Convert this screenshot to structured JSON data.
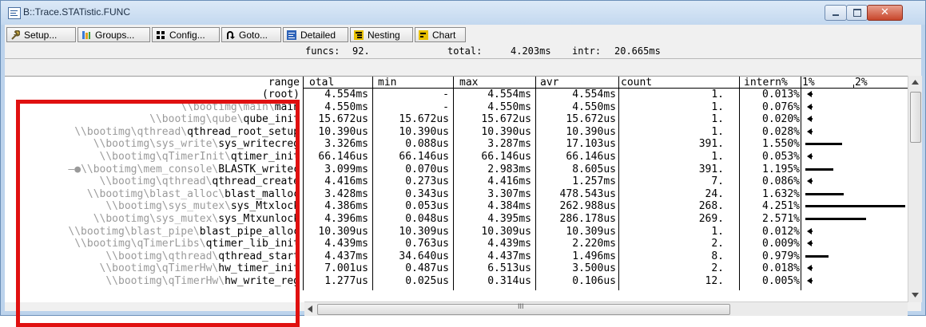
{
  "window": {
    "title": "B::Trace.STATistic.FUNC",
    "close_glyph": "✕"
  },
  "toolbar": {
    "setup": "Setup...",
    "groups": "Groups...",
    "config": "Config...",
    "goto": "Goto...",
    "detailed": "Detailed",
    "nesting": "Nesting",
    "chart": "Chart"
  },
  "info": {
    "funcs_label": "funcs:",
    "funcs_value": "92.",
    "total_label": "total:",
    "total_value": "4.203ms",
    "intr_label": "intr:",
    "intr_value": "20.665ms"
  },
  "columns": {
    "range": "range",
    "total": "otal",
    "min": "min",
    "max": "max",
    "avr": "avr",
    "count": "count",
    "intern": "intern%",
    "pct1": "1%",
    "pct2": "2%"
  },
  "scroll": {
    "hscroll_grip": "III"
  },
  "rows": [
    {
      "prefix": "",
      "name": "(root)",
      "total": "4.554ms",
      "min": "-",
      "max": "4.554ms",
      "avr": "4.554ms",
      "count": "1.",
      "intern": "0.013%",
      "intern_value": 0.013
    },
    {
      "prefix": "\\\\bootimg\\main\\",
      "name": "main",
      "total": "4.550ms",
      "min": "-",
      "max": "4.550ms",
      "avr": "4.550ms",
      "count": "1.",
      "intern": "0.076%",
      "intern_value": 0.076
    },
    {
      "prefix": "\\\\bootimg\\qube\\",
      "name": "qube_init",
      "total": "15.672us",
      "min": "15.672us",
      "max": "15.672us",
      "avr": "15.672us",
      "count": "1.",
      "intern": "0.020%",
      "intern_value": 0.02
    },
    {
      "prefix": "\\\\bootimg\\qthread\\",
      "name": "qthread_root_setup",
      "total": "10.390us",
      "min": "10.390us",
      "max": "10.390us",
      "avr": "10.390us",
      "count": "1.",
      "intern": "0.028%",
      "intern_value": 0.028
    },
    {
      "prefix": "\\\\bootimg\\sys_write\\",
      "name": "sys_writecreg",
      "total": "3.326ms",
      "min": "0.088us",
      "max": "3.287ms",
      "avr": "17.103us",
      "count": "391.",
      "intern": "1.550%",
      "intern_value": 1.55
    },
    {
      "prefix": "\\\\bootimg\\qTimerInit\\",
      "name": "qtimer_init",
      "total": "66.146us",
      "min": "66.146us",
      "max": "66.146us",
      "avr": "66.146us",
      "count": "1.",
      "intern": "0.053%",
      "intern_value": 0.053
    },
    {
      "prefix": "\\\\bootimg\\mem_console\\",
      "name": "BLASTK_writec",
      "total": "3.099ms",
      "min": "0.070us",
      "max": "2.983ms",
      "avr": "8.605us",
      "count": "391.",
      "intern": "1.195%",
      "intern_value": 1.195,
      "marker": "—●"
    },
    {
      "prefix": "\\\\bootimg\\qthread\\",
      "name": "qthread_create",
      "total": "4.416ms",
      "min": "0.273us",
      "max": "4.416ms",
      "avr": "1.257ms",
      "count": "7.",
      "intern": "0.086%",
      "intern_value": 0.086
    },
    {
      "prefix": "\\\\bootimg\\blast_alloc\\",
      "name": "blast_malloc",
      "total": "3.428ms",
      "min": "0.343us",
      "max": "3.307ms",
      "avr": "478.543us",
      "count": "24.",
      "intern": "1.632%",
      "intern_value": 1.632
    },
    {
      "prefix": "\\\\bootimg\\sys_mutex\\",
      "name": "sys_Mtxlock",
      "total": "4.386ms",
      "min": "0.053us",
      "max": "4.384ms",
      "avr": "262.988us",
      "count": "268.",
      "intern": "4.251%",
      "intern_value": 4.251
    },
    {
      "prefix": "\\\\bootimg\\sys_mutex\\",
      "name": "sys_Mtxunlock",
      "total": "4.396ms",
      "min": "0.048us",
      "max": "4.395ms",
      "avr": "286.178us",
      "count": "269.",
      "intern": "2.571%",
      "intern_value": 2.571
    },
    {
      "prefix": "\\\\bootimg\\blast_pipe\\",
      "name": "blast_pipe_alloc",
      "total": "10.309us",
      "min": "10.309us",
      "max": "10.309us",
      "avr": "10.309us",
      "count": "1.",
      "intern": "0.012%",
      "intern_value": 0.012
    },
    {
      "prefix": "\\\\bootimg\\qTimerLibs\\",
      "name": "qtimer_lib_init",
      "total": "4.439ms",
      "min": "0.763us",
      "max": "4.439ms",
      "avr": "2.220ms",
      "count": "2.",
      "intern": "0.009%",
      "intern_value": 0.009
    },
    {
      "prefix": "\\\\bootimg\\qthread\\",
      "name": "qthread_start",
      "total": "4.437ms",
      "min": "34.640us",
      "max": "4.437ms",
      "avr": "1.496ms",
      "count": "8.",
      "intern": "0.979%",
      "intern_value": 0.979
    },
    {
      "prefix": "\\\\bootimg\\qTimerHw\\",
      "name": "hw_timer_init",
      "total": "7.001us",
      "min": "0.487us",
      "max": "6.513us",
      "avr": "3.500us",
      "count": "2.",
      "intern": "0.018%",
      "intern_value": 0.018
    },
    {
      "prefix": "\\\\bootimg\\qTimerHw\\",
      "name": "hw_write_reg",
      "total": "1.277us",
      "min": "0.025us",
      "max": "0.314us",
      "avr": "0.106us",
      "count": "12.",
      "intern": "0.005%",
      "intern_value": 0.005
    }
  ]
}
